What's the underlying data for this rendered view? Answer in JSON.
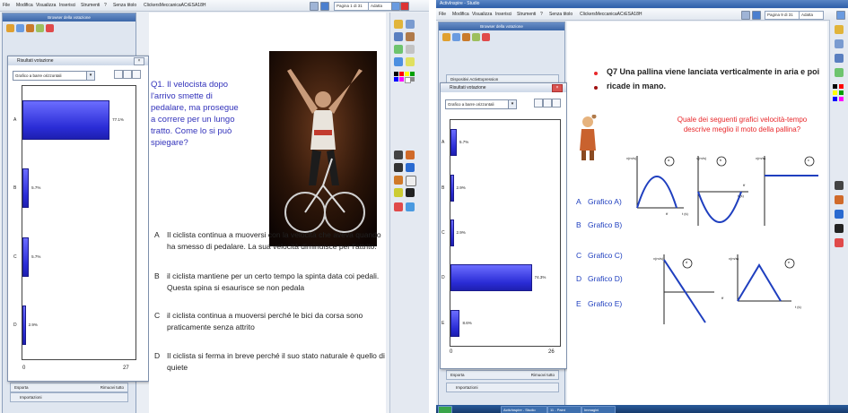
{
  "left": {
    "menu": [
      "File",
      "Modifica",
      "Visualizza",
      "Inserisci",
      "Strumenti",
      "?"
    ],
    "tab_blank": "Senza titolo",
    "tab_file": "ClickersMeccanicaACrESA18H",
    "page_indicator": "Pagina 1 di 31",
    "fit_label": "Adatta",
    "browser_title": "Browser della votazione",
    "results_title": "Risultati votazione",
    "chart_type_select": "Grafico a barre orizzontali",
    "chart_data": {
      "type": "bar",
      "orientation": "horizontal",
      "categories": [
        "A",
        "B",
        "C",
        "D"
      ],
      "values": [
        77.1,
        5.7,
        5.7,
        2.9
      ],
      "value_labels": [
        "77.1%",
        "5.7%",
        "5.7%",
        "2.9%"
      ],
      "xlim": [
        0,
        27
      ],
      "x_ticks": [
        "0",
        "27"
      ]
    },
    "export_label": "Esporta",
    "reset_label": "Rimuovi tutto",
    "import_label": "Importazioni",
    "question": "Q1. Il velocista dopo l'arrivo smette di pedalare, ma prosegue a correre per un lungo tratto. Come lo si può spiegare?",
    "answers": [
      {
        "letter": "A",
        "text": "Il ciclista continua a muoversi con la velocità che aveva quando ha smesso di pedalare. La sua velocità diminuisce per l'attrito."
      },
      {
        "letter": "B",
        "text": "il ciclista mantiene per un certo tempo la spinta data coi pedali. Questa spina si esaurisce se non pedala"
      },
      {
        "letter": "C",
        "text": "il ciclista continua a muoversi perché le bici da corsa sono praticamente senza attrito"
      },
      {
        "letter": "D",
        "text": "Il ciclista si ferma in breve perché il suo stato naturale è quello di quiete"
      }
    ]
  },
  "right": {
    "window_title": "ActivInspire - Studio",
    "menu": [
      "File",
      "Modifica",
      "Visualizza",
      "Inserisci",
      "Strumenti",
      "?"
    ],
    "tab_blank": "Senza titolo",
    "tab_file": "ClickersMeccanicaACrESA18H",
    "page_indicator": "Pagina 9 di 31",
    "fit_label": "Adatta",
    "browser_title": "Browser della votazione",
    "results_title": "Risultati votazione",
    "device_label": "Dispositivi ActivExpression",
    "chart_type_select": "Grafico a barre orizzontali",
    "chart_data": {
      "type": "bar",
      "orientation": "horizontal",
      "categories": [
        "A",
        "B",
        "C",
        "D",
        "E"
      ],
      "values": [
        5.7,
        2.9,
        2.9,
        74.3,
        8.6
      ],
      "value_labels": [
        "5.7%",
        "2.9%",
        "2.9%",
        "74.3%",
        "8.6%"
      ],
      "xlim": [
        0,
        26
      ],
      "x_ticks": [
        "0",
        "26"
      ]
    },
    "export_label": "Esporta",
    "reset_label": "Rimuovi tutto",
    "import_label": "Importazioni",
    "question_line1": "Q7 Una pallina viene lanciata verticalmente in aria e poi",
    "question_line2": "ricade in mano.",
    "sub_question": "Quale dei seguenti grafici velocità-tempo descrive meglio il moto della pallina?",
    "options": [
      {
        "letter": "A",
        "text": "Grafico A)"
      },
      {
        "letter": "B",
        "text": "Grafico B)"
      },
      {
        "letter": "C",
        "text": "Grafico C)"
      },
      {
        "letter": "D",
        "text": "Grafico D)"
      },
      {
        "letter": "E",
        "text": "Grafico E)"
      }
    ],
    "graph_marks": [
      "a",
      "b",
      "c",
      "d",
      "e"
    ],
    "axis_v": "v(m/s)",
    "axis_t": "t (s)",
    "axis_tf": "tf",
    "taskbar": [
      "ActivInspire - Studio",
      "11 - Paint",
      "Immagini"
    ]
  },
  "colors": {
    "bar": "#2a2cd6",
    "question_blue": "#3333bb",
    "red_text": "#e8282b",
    "option_blue": "#1f3fbf"
  }
}
